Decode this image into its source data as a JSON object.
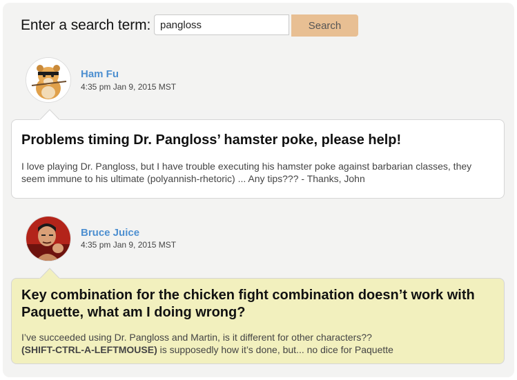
{
  "search": {
    "label": "Enter a search term:",
    "value": "pangloss",
    "button_label": "Search"
  },
  "posts": [
    {
      "author": "Ham Fu",
      "timestamp": "4:35 pm Jan 9, 2015 MST",
      "title": "Problems timing Dr. Pangloss’ hamster poke, please help!",
      "body": "I love playing Dr. Pangloss, but I have trouble executing his hamster poke against barbarian classes, they seem immune to his ultimate (polyannish-rhetoric) ... Any tips??? - Thanks, John",
      "avatar_icon": "hamster-avatar-icon",
      "bubble_color": "#ffffff"
    },
    {
      "author": "Bruce Juice",
      "timestamp": "4:35 pm Jan 9, 2015 MST",
      "title": "Key combination for the chicken fight combination doesn’t work with Paquette, what am I doing wrong?",
      "body_line1": "I’ve succeeded using Dr. Pangloss and Martin, is it different for other characters??",
      "body_bold": "(SHIFT-CTRL-A-LEFTMOUSE)",
      "body_rest": " is supposedly how it’s done, but... no dice for Paquette",
      "avatar_icon": "fighter-avatar-icon",
      "bubble_color": "#f2f0be"
    }
  ],
  "colors": {
    "author_link": "#4d8fd0",
    "search_button": "#e8bf93",
    "panel_bg": "#f3f3f2"
  }
}
